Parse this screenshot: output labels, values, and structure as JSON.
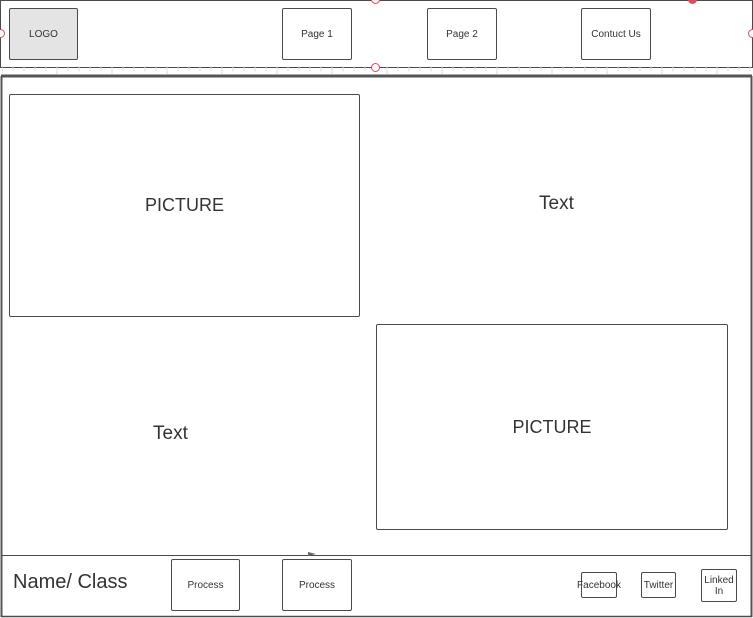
{
  "header": {
    "logo_label": "LOGO",
    "nav": [
      "Page 1",
      "Page 2",
      "Contuct Us"
    ]
  },
  "main": {
    "picture_top": "PICTURE",
    "text_top": "Text",
    "text_bottom": "Text",
    "picture_bottom": "PICTURE"
  },
  "footer": {
    "name_class": "Name/ Class",
    "process_buttons": [
      "Process",
      "Process"
    ],
    "social": [
      "Facebook",
      "Twitter",
      "Linked In"
    ]
  },
  "colors": {
    "border": "#4a4a4a",
    "logo_fill": "#e4e4e4",
    "selection_handle": "#e04a5a"
  }
}
